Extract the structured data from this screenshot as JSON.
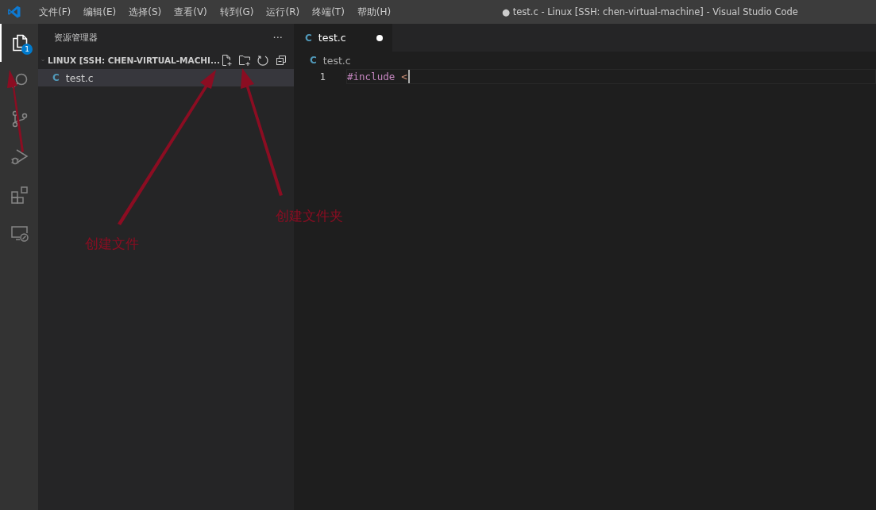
{
  "title_bar": {
    "menu": [
      "文件(F)",
      "编辑(E)",
      "选择(S)",
      "查看(V)",
      "转到(G)",
      "运行(R)",
      "终端(T)",
      "帮助(H)"
    ],
    "title": "● test.c - Linux [SSH: chen-virtual-machine] - Visual Studio Code"
  },
  "activity_bar": {
    "items": [
      {
        "kind": "explorer",
        "selected": true,
        "badge": "1"
      },
      {
        "kind": "search",
        "selected": false
      },
      {
        "kind": "source-control",
        "selected": false
      },
      {
        "kind": "run-debug",
        "selected": false
      },
      {
        "kind": "extensions",
        "selected": false
      },
      {
        "kind": "remote",
        "selected": false
      }
    ]
  },
  "sidebar": {
    "title": "资源管理器",
    "more": "···",
    "section": {
      "title": "LINUX [SSH: CHEN-VIRTUAL-MACHI...",
      "expanded": true
    },
    "files": [
      {
        "icon": "C",
        "name": "test.c",
        "selected": true
      }
    ]
  },
  "editor": {
    "tabs": [
      {
        "icon": "C",
        "label": "test.c",
        "dirty": true,
        "selected": true
      }
    ],
    "breadcrumb": {
      "icon": "C",
      "label": "test.c"
    },
    "lines": [
      {
        "number": "1",
        "keyword": "#include",
        "text": "<"
      }
    ]
  },
  "annotations": [
    {
      "label": "创建文件"
    },
    {
      "label": "创建文件夹"
    }
  ]
}
